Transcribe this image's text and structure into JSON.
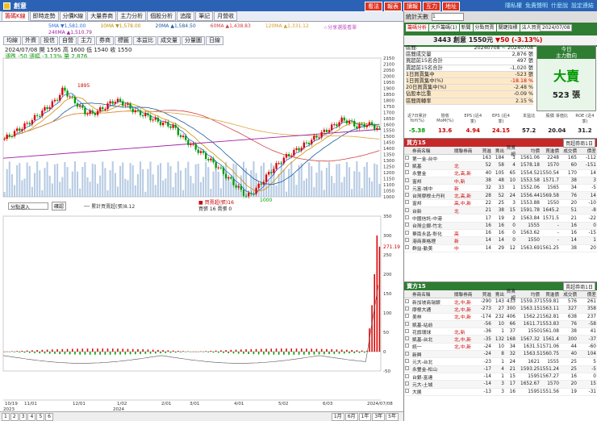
{
  "window": {
    "title": "創意"
  },
  "top_buttons": [
    "看法",
    "報表",
    "讀報",
    "互力",
    "地址"
  ],
  "top_links": [
    "隱私權",
    "免責聲明",
    "什麼說",
    "設定連結"
  ],
  "menu": [
    "籌碼K線",
    "即時走勢",
    "分價K線",
    "大量券商",
    "主力分析",
    "個股分析",
    "追蹤",
    "筆記",
    "月營收"
  ],
  "ma_legend": {
    "ma5": "5MA ▼1,581.00",
    "ma10": "10MA ▼1,578.00",
    "ma20": "20MA ▲1,584.50",
    "ma60": "60MA ▲1,438.83",
    "ma120": "120MA ▲1,331.12",
    "ma240": "240MA ▲1,510.79",
    "extra": "☆分享選股看單"
  },
  "sub_tabs": [
    "均線",
    "外資",
    "投信",
    "自營",
    "主力",
    "券商",
    "標籤",
    "本益比",
    "成交量",
    "分量圖",
    "日線"
  ],
  "info_line1": "2024/07/08 開 1595 高 1600 低 1540 收 1550",
  "info_line2_a": "漲跌 -50",
  "info_line2_b": "漲幅 -3.13% 量 2,876",
  "price_axis": [
    "2150",
    "2100",
    "2050",
    "2000",
    "1950",
    "1900",
    "1850",
    "1800",
    "1750",
    "1700",
    "1650",
    "1600",
    "1550",
    "1500",
    "1450",
    "1400",
    "1350",
    "1300",
    "1250",
    "1200",
    "1150",
    "1100",
    "1050",
    "1000"
  ],
  "peak_label": "1895",
  "low_label": "1000",
  "vol_select": "分點選入",
  "vol_btn": "確認",
  "vol_legend": "── 累計買賣超(張)8.12",
  "vol_legend2": [
    "■ 買賣超(張)16",
    "買張 16 賣張 0"
  ],
  "vol_axis": [
    "350",
    "300",
    "250",
    "200",
    "150",
    "100",
    "50",
    "0",
    "-50"
  ],
  "vol_last": "271.19",
  "date_axis": [
    "10/19",
    "11/01",
    "12/01",
    "1/02",
    "2/01",
    "3/01",
    "4/01",
    "5/02",
    "6/03",
    "2024/07/08"
  ],
  "date_years": [
    "2023",
    "2024"
  ],
  "bottom_buttons": [
    "1",
    "2",
    "3",
    "4",
    "5",
    "6"
  ],
  "zoom_buttons": [
    "1月",
    "6月",
    "1年",
    "3年",
    "5年"
  ],
  "right": {
    "head_label": "統計天數",
    "head_val": "1",
    "tabs": [
      "籌碼分析",
      "大戶籌碼(1)",
      "新聞",
      "分點買賣",
      "關鍵指標",
      "法人買賣(2015日)"
    ],
    "date": "2024/07/08",
    "stock": "3443 創意",
    "price": "1550元",
    "chg": "▼50 (-3.13%)",
    "summary": [
      {
        "k": "區間:",
        "v": "20240708 ~ 20240708"
      },
      {
        "k": "區間成交量",
        "v": "2,876 張"
      },
      {
        "k": "買超前15名合計",
        "v": "497 張"
      },
      {
        "k": "賣超前15名合計",
        "v": "-1,020 張"
      },
      {
        "k": "1日買賣集中",
        "v": "-523 張"
      },
      {
        "k": "1日買賣集中(%)",
        "v": "-18.18 %"
      },
      {
        "k": "20日買賣集中(%)",
        "v": "-2.48 %"
      },
      {
        "k": "佔股本比重",
        "v": "-0.09 %"
      },
      {
        "k": "區間周轉率",
        "v": "2.15 %"
      }
    ],
    "box_head1": "今日",
    "box_head2": "主力動向",
    "box_big": "大賣",
    "box_num": "523 張",
    "stats_labels": [
      "近7日累計 YoY(%)",
      "營收 MoM(%)",
      "EPS (近4季)",
      "EPS (近4季)",
      "本益比",
      "股價 淨值比",
      "ROE (近4季)"
    ],
    "stats_vals": [
      "-5.38",
      "13.6",
      "4.94",
      "24.15",
      "57.2",
      "20.04",
      "31.2"
    ],
    "buy_title": "買方15",
    "buy_sel": "買超券商1日",
    "cols": [
      "券商名稱",
      "關聯券商",
      "買進",
      "賣出",
      "買賣超",
      "均價",
      "買進價",
      "成交價",
      "價差"
    ],
    "buy": [
      [
        "第一金-台中",
        "",
        "163",
        "184",
        "1",
        "1561.06",
        "2248",
        "165",
        "-112"
      ],
      [
        "凱基",
        "北",
        "52",
        "58",
        "4",
        "1578.18",
        "1570",
        "60",
        "-151"
      ],
      [
        "永豐金",
        "北,高,新",
        "40",
        "105",
        "65",
        "1554.52",
        "1550.54",
        "170",
        "14"
      ],
      [
        "富邦",
        "中,新",
        "38",
        "48",
        "10",
        "1553.58",
        "1571.7",
        "38",
        "3"
      ],
      [
        "元富-城中",
        "新",
        "32",
        "33",
        "1",
        "1552.06",
        "1565",
        "34",
        "-5"
      ],
      [
        "台灣摩根士丹利",
        "北,高,新",
        "28",
        "52",
        "24",
        "1556.44",
        "1569.58",
        "76",
        "14"
      ],
      [
        "富邦",
        "高,中,新",
        "22",
        "25",
        "3",
        "1553.88",
        "1550",
        "20",
        "-10"
      ],
      [
        "台新",
        "北",
        "21",
        "38",
        "15",
        "1591.78",
        "1645.2",
        "51",
        "-8"
      ],
      [
        "中國信託-中港",
        "",
        "17",
        "19",
        "2",
        "1563.84",
        "1571.5",
        "21",
        "-22"
      ],
      [
        "台灣企銀-竹北",
        "",
        "16",
        "16",
        "0",
        "1555",
        "-",
        "16",
        "0"
      ],
      [
        "華南永昌-彰化",
        "高",
        "16",
        "16",
        "0",
        "1563.62",
        "-",
        "16",
        "-15"
      ],
      [
        "港商麥格理",
        "新",
        "14",
        "14",
        "0",
        "1550",
        "-",
        "14",
        "1"
      ],
      [
        "群益-勤美",
        "中",
        "14",
        "29",
        "12",
        "1563.69",
        "1561.25",
        "38",
        "20"
      ]
    ],
    "sell_title": "賣方15",
    "sell_sel": "賣超券商1日",
    "sell": [
      [
        "新加坡商瑞銀",
        "北,中,新",
        "-290",
        "143",
        "433",
        "1559.37",
        "1559.81",
        "576",
        "261"
      ],
      [
        "摩根大通",
        "北,中,新",
        "-273",
        "27",
        "300",
        "1563.15",
        "1563.11",
        "327",
        "358"
      ],
      [
        "美林",
        "北,中,新",
        "-174",
        "232",
        "406",
        "1562.2",
        "1562.81",
        "638",
        "237"
      ],
      [
        "凱基-站前",
        "",
        "-56",
        "10",
        "66",
        "1611.7",
        "1553.83",
        "76",
        "-58"
      ],
      [
        "花旗環球",
        "北,新",
        "-36",
        "1",
        "37",
        "1550",
        "1561.08",
        "38",
        "41"
      ],
      [
        "凱基-台北",
        "北,中,新",
        "-35",
        "132",
        "168",
        "1567.32",
        "1561.4",
        "300",
        "-37"
      ],
      [
        "統一",
        "北,中,新",
        "-24",
        "10",
        "34",
        "1631.5",
        "1571.06",
        "44",
        "-60"
      ],
      [
        "新興",
        "",
        "-24",
        "8",
        "32",
        "1563.5",
        "1560.75",
        "40",
        "104"
      ],
      [
        "元大-台北",
        "",
        "-23",
        "1",
        "24",
        "1621",
        "1555",
        "25",
        "5"
      ],
      [
        "永豐金-松山",
        "",
        "-17",
        "4",
        "21",
        "1593.25",
        "1551.24",
        "25",
        "-5"
      ],
      [
        "台銀-富達",
        "",
        "-14",
        "1",
        "15",
        "1595",
        "1567.27",
        "16",
        "0"
      ],
      [
        "元大-土城",
        "",
        "-14",
        "3",
        "17",
        "1652.67",
        "1570",
        "20",
        "15"
      ],
      [
        "大展",
        "",
        "-13",
        "3",
        "16",
        "1595",
        "1551.56",
        "19",
        "-31"
      ]
    ]
  },
  "chart_data": {
    "type": "candlestick",
    "title": "",
    "price_range": [
      1000,
      2150
    ],
    "volume_range": [
      -50,
      350
    ],
    "close_series_sample": [
      1480,
      1520,
      1560,
      1600,
      1650,
      1700,
      1750,
      1800,
      1895,
      1820,
      1760,
      1700,
      1690,
      1720,
      1760,
      1800,
      1780,
      1740,
      1700,
      1680,
      1650,
      1620,
      1600,
      1580,
      1500,
      1450,
      1400,
      1350,
      1300,
      1250,
      1180,
      1120,
      1060,
      1000,
      1050,
      1120,
      1200,
      1260,
      1320,
      1360,
      1400,
      1440,
      1480,
      1520,
      1560,
      1600,
      1640,
      1620,
      1580,
      1600,
      1595,
      1550
    ],
    "last_volume": 271.19,
    "peak": 1895,
    "trough": 1000
  }
}
